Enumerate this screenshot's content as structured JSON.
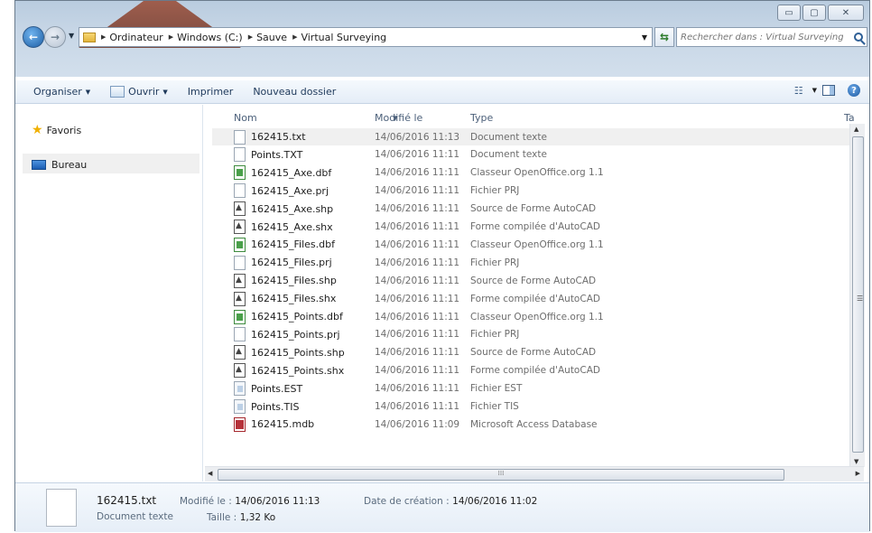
{
  "window": {
    "caption": {
      "minimize": "▭",
      "maximize": "▢",
      "close": "✕"
    }
  },
  "address": {
    "crumbs": [
      "Ordinateur",
      "Windows (C:)",
      "Sauve",
      "Virtual Surveying"
    ],
    "search_placeholder": "Rechercher dans : Virtual Surveying"
  },
  "toolbar": {
    "organiser": "Organiser",
    "ouvrir": "Ouvrir",
    "imprimer": "Imprimer",
    "nouveau_dossier": "Nouveau dossier"
  },
  "nav": {
    "favoris": "Favoris",
    "bureau": "Bureau"
  },
  "columns": {
    "name": "Nom",
    "modified": "Modifié le",
    "type": "Type",
    "size_truncated": "Ta"
  },
  "files": [
    {
      "name": "162415.txt",
      "date": "14/06/2016 11:13",
      "type": "Document texte",
      "icon": "txt"
    },
    {
      "name": "Points.TXT",
      "date": "14/06/2016 11:11",
      "type": "Document texte",
      "icon": "txt"
    },
    {
      "name": "162415_Axe.dbf",
      "date": "14/06/2016 11:11",
      "type": "Classeur OpenOffice.org 1.1",
      "icon": "dbf"
    },
    {
      "name": "162415_Axe.prj",
      "date": "14/06/2016 11:11",
      "type": "Fichier PRJ",
      "icon": "txt"
    },
    {
      "name": "162415_Axe.shp",
      "date": "14/06/2016 11:11",
      "type": "Source de Forme AutoCAD",
      "icon": "shp"
    },
    {
      "name": "162415_Axe.shx",
      "date": "14/06/2016 11:11",
      "type": "Forme compilée d'AutoCAD",
      "icon": "shp"
    },
    {
      "name": "162415_Files.dbf",
      "date": "14/06/2016 11:11",
      "type": "Classeur OpenOffice.org 1.1",
      "icon": "dbf"
    },
    {
      "name": "162415_Files.prj",
      "date": "14/06/2016 11:11",
      "type": "Fichier PRJ",
      "icon": "txt"
    },
    {
      "name": "162415_Files.shp",
      "date": "14/06/2016 11:11",
      "type": "Source de Forme AutoCAD",
      "icon": "shp"
    },
    {
      "name": "162415_Files.shx",
      "date": "14/06/2016 11:11",
      "type": "Forme compilée d'AutoCAD",
      "icon": "shp"
    },
    {
      "name": "162415_Points.dbf",
      "date": "14/06/2016 11:11",
      "type": "Classeur OpenOffice.org 1.1",
      "icon": "dbf"
    },
    {
      "name": "162415_Points.prj",
      "date": "14/06/2016 11:11",
      "type": "Fichier PRJ",
      "icon": "txt"
    },
    {
      "name": "162415_Points.shp",
      "date": "14/06/2016 11:11",
      "type": "Source de Forme AutoCAD",
      "icon": "shp"
    },
    {
      "name": "162415_Points.shx",
      "date": "14/06/2016 11:11",
      "type": "Forme compilée d'AutoCAD",
      "icon": "shp"
    },
    {
      "name": "Points.EST",
      "date": "14/06/2016 11:11",
      "type": "Fichier EST",
      "icon": "est"
    },
    {
      "name": "Points.TIS",
      "date": "14/06/2016 11:11",
      "type": "Fichier TIS",
      "icon": "est"
    },
    {
      "name": "162415.mdb",
      "date": "14/06/2016 11:09",
      "type": "Microsoft Access Database",
      "icon": "mdb"
    }
  ],
  "details": {
    "name": "162415.txt",
    "type": "Document texte",
    "modified_label": "Modifié le :",
    "modified_value": "14/06/2016 11:13",
    "size_label": "Taille :",
    "size_value": "1,32 Ko",
    "created_label": "Date de création :",
    "created_value": "14/06/2016 11:02"
  }
}
